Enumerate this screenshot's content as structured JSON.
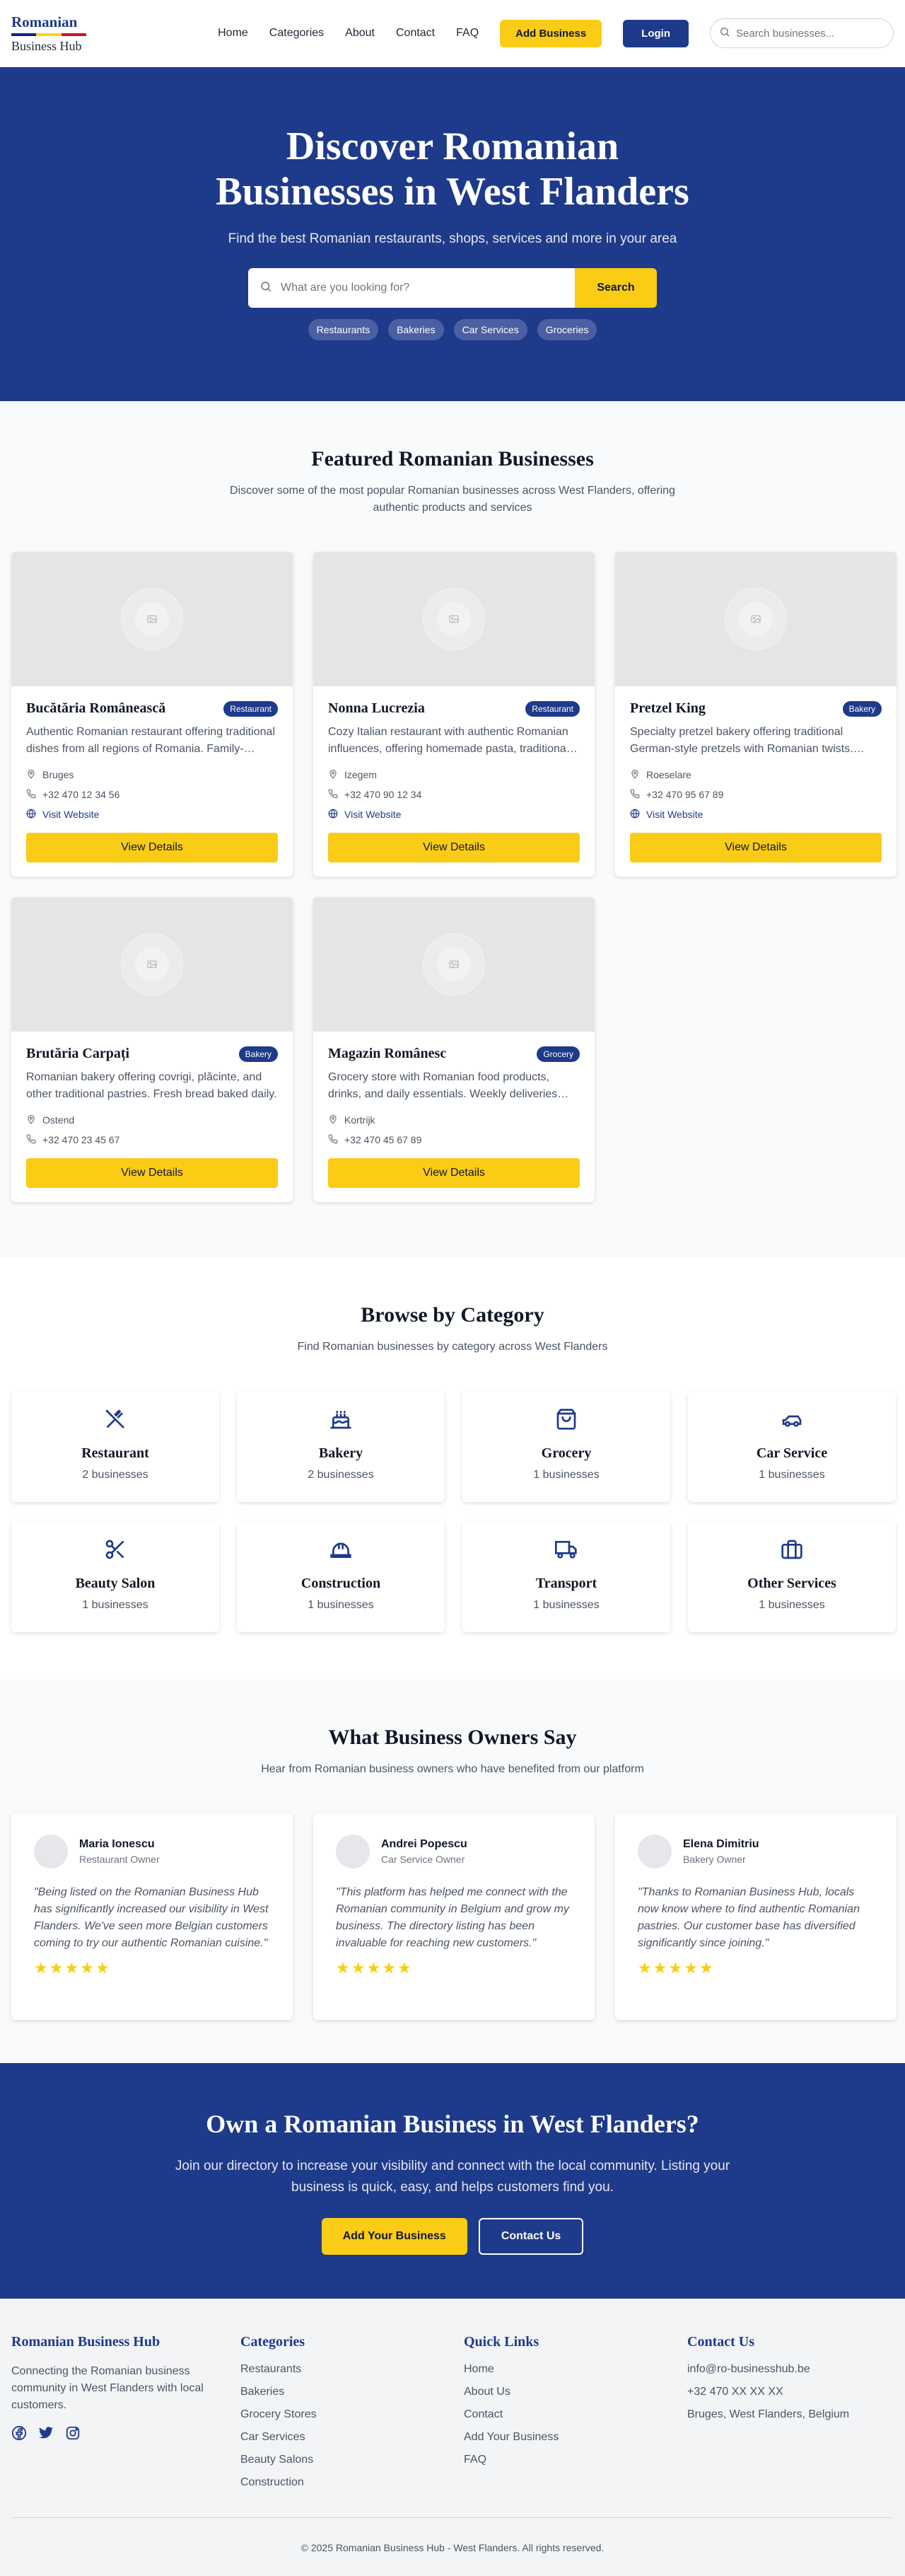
{
  "colors": {
    "brand": "#1e3a8a",
    "accent": "#facc15",
    "flag_blue": "#002b7f",
    "flag_yellow": "#fcd116",
    "flag_red": "#ce1126"
  },
  "header": {
    "logo_top": "Romanian",
    "logo_bottom": "Business Hub",
    "nav": [
      "Home",
      "Categories",
      "About",
      "Contact",
      "FAQ"
    ],
    "add_business": "Add Business",
    "login": "Login",
    "search_placeholder": "Search businesses..."
  },
  "hero": {
    "title_line1": "Discover Romanian",
    "title_line2": "Businesses in West Flanders",
    "subtitle": "Find the best Romanian restaurants, shops, services and more in your area",
    "search_placeholder": "What are you looking for?",
    "search_button": "Search",
    "chips": [
      "Restaurants",
      "Bakeries",
      "Car Services",
      "Groceries"
    ]
  },
  "featured": {
    "title": "Featured Romanian Businesses",
    "subtitle": "Discover some of the most popular Romanian businesses across West Flanders, offering authentic products and services",
    "view_label": "View Details",
    "website_label": "Visit Website",
    "items": [
      {
        "name": "Bucătăria Românească",
        "badge": "Restaurant",
        "desc": "Authentic Romanian restaurant offering traditional dishes from all regions of Romania. Family-…",
        "city": "Bruges",
        "phone": "+32 470 12 34 56",
        "website": true
      },
      {
        "name": "Nonna Lucrezia",
        "badge": "Restaurant",
        "desc": "Cozy Italian restaurant with authentic Romanian influences, offering homemade pasta, traditiona…",
        "city": "Izegem",
        "phone": "+32 470 90 12 34",
        "website": true
      },
      {
        "name": "Pretzel King",
        "badge": "Bakery",
        "desc": "Specialty pretzel bakery offering traditional German-style pretzels with Romanian twists.…",
        "city": "Roeselare",
        "phone": "+32 470 95 67 89",
        "website": true
      },
      {
        "name": "Brutăria Carpați",
        "badge": "Bakery",
        "desc": "Romanian bakery offering covrigi, plăcinte, and other traditional pastries. Fresh bread baked daily.",
        "city": "Ostend",
        "phone": "+32 470 23 45 67",
        "website": false
      },
      {
        "name": "Magazin Românesc",
        "badge": "Grocery",
        "desc": "Grocery store with Romanian food products, drinks, and daily essentials. Weekly deliveries…",
        "city": "Kortrijk",
        "phone": "+32 470 45 67 89",
        "website": false
      }
    ]
  },
  "categories": {
    "title": "Browse by Category",
    "subtitle": "Find Romanian businesses by category across West Flanders",
    "items": [
      {
        "name": "Restaurant",
        "count": "2 businesses",
        "icon": "utensils-icon"
      },
      {
        "name": "Bakery",
        "count": "2 businesses",
        "icon": "cake-icon"
      },
      {
        "name": "Grocery",
        "count": "1 businesses",
        "icon": "shopping-bag-icon"
      },
      {
        "name": "Car Service",
        "count": "1 businesses",
        "icon": "car-icon"
      },
      {
        "name": "Beauty Salon",
        "count": "1 businesses",
        "icon": "scissors-icon"
      },
      {
        "name": "Construction",
        "count": "1 businesses",
        "icon": "hard-hat-icon"
      },
      {
        "name": "Transport",
        "count": "1 businesses",
        "icon": "truck-icon"
      },
      {
        "name": "Other Services",
        "count": "1 businesses",
        "icon": "briefcase-icon"
      }
    ]
  },
  "testimonials": {
    "title": "What Business Owners Say",
    "subtitle": "Hear from Romanian business owners who have benefited from our platform",
    "items": [
      {
        "name": "Maria Ionescu",
        "role": "Restaurant Owner",
        "quote": "\"Being listed on the Romanian Business Hub has significantly increased our visibility in West Flanders. We've seen more Belgian customers coming to try our authentic Romanian cuisine.\"",
        "rating": 5
      },
      {
        "name": "Andrei Popescu",
        "role": "Car Service Owner",
        "quote": "\"This platform has helped me connect with the Romanian community in Belgium and grow my business. The directory listing has been invaluable for reaching new customers.\"",
        "rating": 5
      },
      {
        "name": "Elena Dimitriu",
        "role": "Bakery Owner",
        "quote": "\"Thanks to Romanian Business Hub, locals now know where to find authentic Romanian pastries. Our customer base has diversified significantly since joining.\"",
        "rating": 5
      }
    ]
  },
  "cta": {
    "title": "Own a Romanian Business in West Flanders?",
    "text": "Join our directory to increase your visibility and connect with the local community. Listing your business is quick, easy, and helps customers find you.",
    "add_button": "Add Your Business",
    "contact_button": "Contact Us"
  },
  "footer": {
    "about_title": "Romanian Business Hub",
    "about_text": "Connecting the Romanian business community in West Flanders with local customers.",
    "categories_title": "Categories",
    "categories": [
      "Restaurants",
      "Bakeries",
      "Grocery Stores",
      "Car Services",
      "Beauty Salons",
      "Construction"
    ],
    "links_title": "Quick Links",
    "links": [
      "Home",
      "About Us",
      "Contact",
      "Add Your Business",
      "FAQ"
    ],
    "contact_title": "Contact Us",
    "contact": [
      "info@ro-businesshub.be",
      "+32 470 XX XX XX",
      "Bruges, West Flanders, Belgium"
    ],
    "copyright": "© 2025 Romanian Business Hub - West Flanders. All rights reserved."
  }
}
